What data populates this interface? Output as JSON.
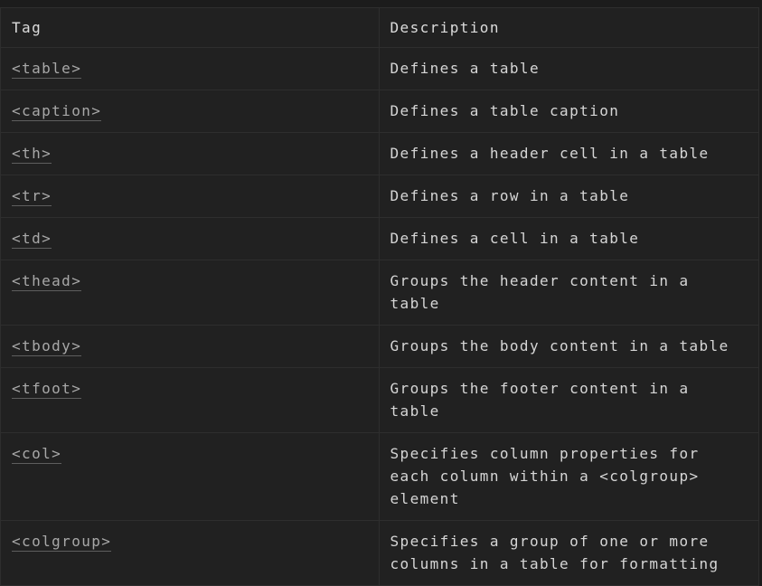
{
  "table": {
    "headers": {
      "tag": "Tag",
      "description": "Description"
    },
    "rows": [
      {
        "tag": "<table>",
        "description": "Defines a table"
      },
      {
        "tag": "<caption>",
        "description": "Defines a table caption"
      },
      {
        "tag": "<th>",
        "description": "Defines a header cell in a table"
      },
      {
        "tag": "<tr>",
        "description": "Defines a row in a table"
      },
      {
        "tag": "<td>",
        "description": "Defines a cell in a table"
      },
      {
        "tag": "<thead>",
        "description": "Groups the header content in a table"
      },
      {
        "tag": "<tbody>",
        "description": "Groups the body content in a table"
      },
      {
        "tag": "<tfoot>",
        "description": "Groups the footer content in a table"
      },
      {
        "tag": "<col>",
        "description": "Specifies column properties for each column within a <colgroup> element"
      },
      {
        "tag": "<colgroup>",
        "description": "Specifies a group of one or more columns in a table for formatting"
      }
    ]
  },
  "colors": {
    "background": "#212121",
    "border": "#2e2e2e",
    "text": "#d6d6d6",
    "link": "#a8a8a8"
  }
}
